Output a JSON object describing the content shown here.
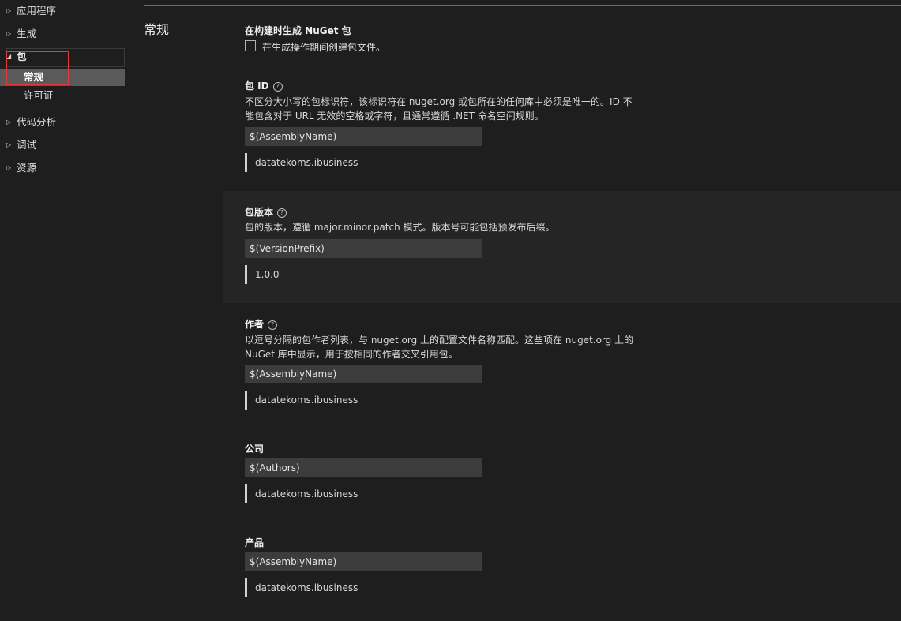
{
  "sidebar": {
    "items": [
      {
        "arrow": "▷",
        "label": "应用程序"
      },
      {
        "arrow": "▷",
        "label": "生成"
      },
      {
        "arrow": "◢",
        "label": "包"
      },
      {
        "arrow": "▷",
        "label": "代码分析"
      },
      {
        "arrow": "▷",
        "label": "调试"
      },
      {
        "arrow": "▷",
        "label": "资源"
      }
    ],
    "package_children": [
      {
        "label": "常规"
      },
      {
        "label": "许可证"
      }
    ]
  },
  "section_title": "常规",
  "generate_on_build": {
    "label": "在构建时生成 NuGet 包",
    "checkbox_label": "在生成操作期间创建包文件。",
    "checked": false
  },
  "package_id": {
    "label": "包 ID",
    "help_icon": "?",
    "desc_line1": "不区分大小写的包标识符，该标识符在 nuget.org 或包所在的任何库中必须是唯一的。ID 不",
    "desc_line2": "能包含对于 URL 无效的空格或字符，且通常遵循 .NET 命名空间规则。",
    "value": "$(AssemblyName)",
    "resolved": "datatekoms.ibusiness"
  },
  "package_version": {
    "label": "包版本",
    "help_icon": "?",
    "desc_line1": "包的版本，遵循 major.minor.patch 模式。版本号可能包括预发布后缀。",
    "value": "$(VersionPrefix)",
    "resolved": "1.0.0"
  },
  "authors": {
    "label": "作者",
    "help_icon": "?",
    "desc_line1": "以逗号分隔的包作者列表，与 nuget.org 上的配置文件名称匹配。这些项在 nuget.org 上的",
    "desc_line2": "NuGet 库中显示，用于按相同的作者交叉引用包。",
    "value": "$(AssemblyName)",
    "resolved": "datatekoms.ibusiness"
  },
  "company": {
    "label": "公司",
    "value": "$(Authors)",
    "resolved": "datatekoms.ibusiness"
  },
  "product": {
    "label": "产品",
    "value": "$(AssemblyName)",
    "resolved": "datatekoms.ibusiness"
  }
}
